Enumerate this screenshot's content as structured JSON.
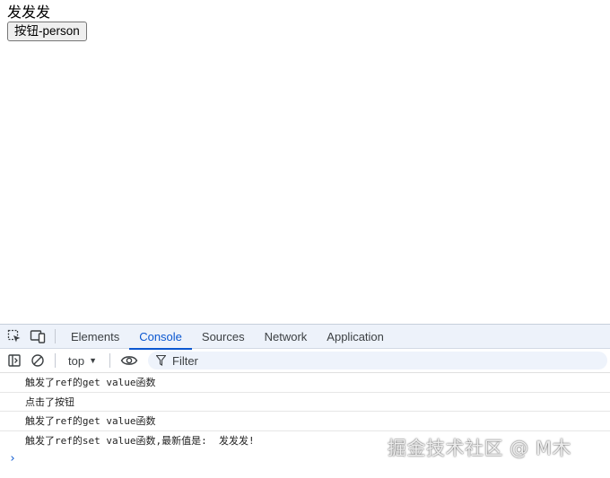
{
  "page": {
    "text": "发发发",
    "button_label": "按钮-person"
  },
  "devtools": {
    "tabs": [
      {
        "label": "Elements",
        "active": false
      },
      {
        "label": "Console",
        "active": true
      },
      {
        "label": "Sources",
        "active": false
      },
      {
        "label": "Network",
        "active": false
      },
      {
        "label": "Application",
        "active": false
      }
    ],
    "toolbar": {
      "context": "top",
      "filter_placeholder": "Filter"
    },
    "messages": [
      "触发了ref的get value函数",
      "点击了按钮",
      "触发了ref的get value函数",
      "触发了ref的set value函数,最新值是:  发发发!"
    ],
    "prompt_symbol": "›"
  },
  "watermark": "掘金技术社区 @ M木",
  "colors": {
    "accent": "#0b57d0",
    "tabbar_bg": "#edf2fa",
    "filter_bg": "#eef3fb"
  }
}
